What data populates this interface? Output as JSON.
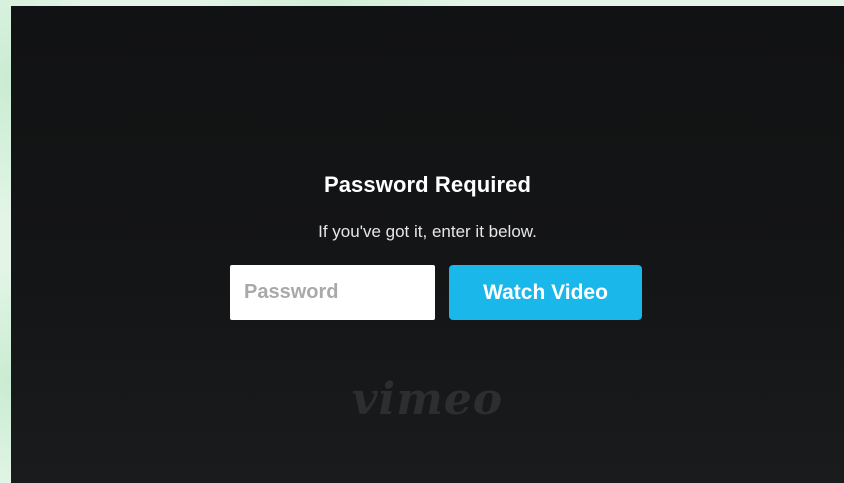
{
  "prompt": {
    "title": "Password Required",
    "subtitle": "If you've got it, enter it below.",
    "password_placeholder": "Password",
    "password_value": "",
    "submit_label": "Watch Video"
  },
  "brand": {
    "logo_text": "vimeo"
  },
  "colors": {
    "accent": "#1ab7ea",
    "player_background": "#131415",
    "page_background": "#e3f5e7"
  }
}
